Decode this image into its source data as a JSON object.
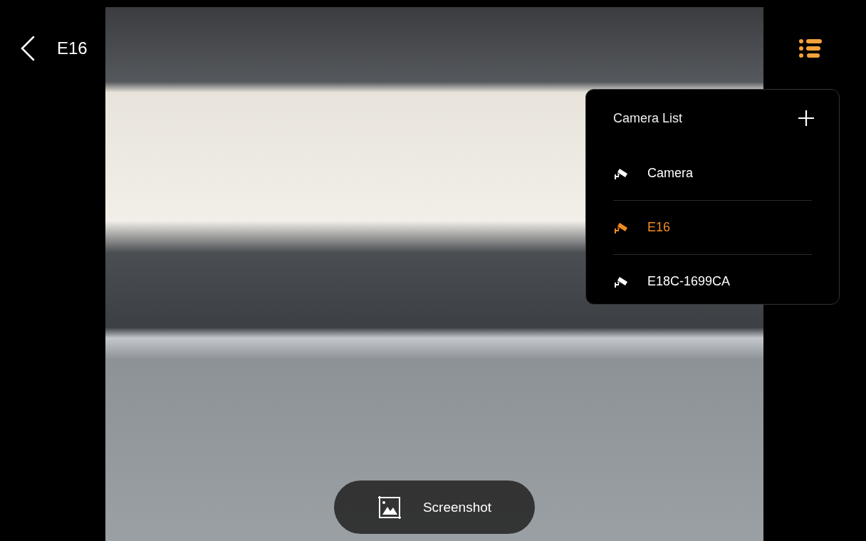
{
  "header": {
    "title": "E16"
  },
  "camera_list": {
    "title": "Camera List",
    "cameras": [
      {
        "name": "Camera",
        "selected": false
      },
      {
        "name": "E16",
        "selected": true
      },
      {
        "name": "E18C-1699CA",
        "selected": false
      }
    ]
  },
  "screenshot_button": {
    "label": "Screenshot"
  }
}
